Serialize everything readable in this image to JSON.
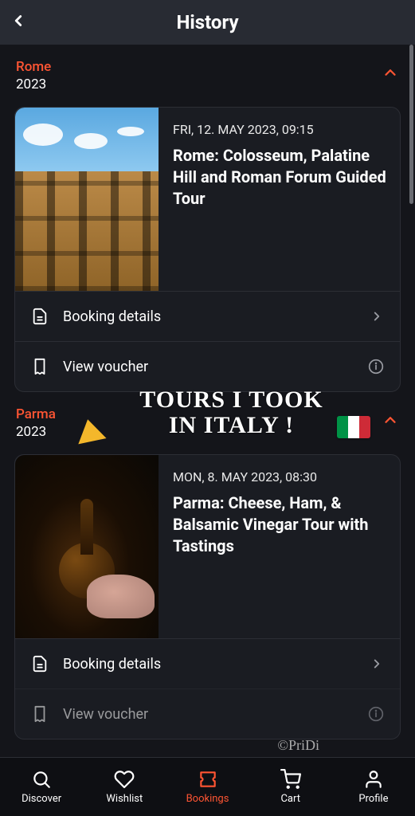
{
  "header": {
    "title": "History"
  },
  "sections": [
    {
      "city": "Rome",
      "year": "2023",
      "card": {
        "date": "FRI, 12. MAY 2023, 09:15",
        "title": "Rome: Colosseum, Palatine Hill and Roman Forum Guided Tour"
      }
    },
    {
      "city": "Parma",
      "year": "2023",
      "card": {
        "date": "MON, 8. MAY 2023, 08:30",
        "title": "Parma: Cheese, Ham, & Balsamic Vinegar Tour with Tastings"
      }
    }
  ],
  "actions": {
    "booking_details": "Booking details",
    "view_voucher": "View voucher"
  },
  "overlay": {
    "line1": "TOURS I TOOK",
    "line2": "IN  ITALY !",
    "watermark": "©PriDi"
  },
  "nav": {
    "discover": "Discover",
    "wishlist": "Wishlist",
    "bookings": "Bookings",
    "cart": "Cart",
    "profile": "Profile"
  }
}
